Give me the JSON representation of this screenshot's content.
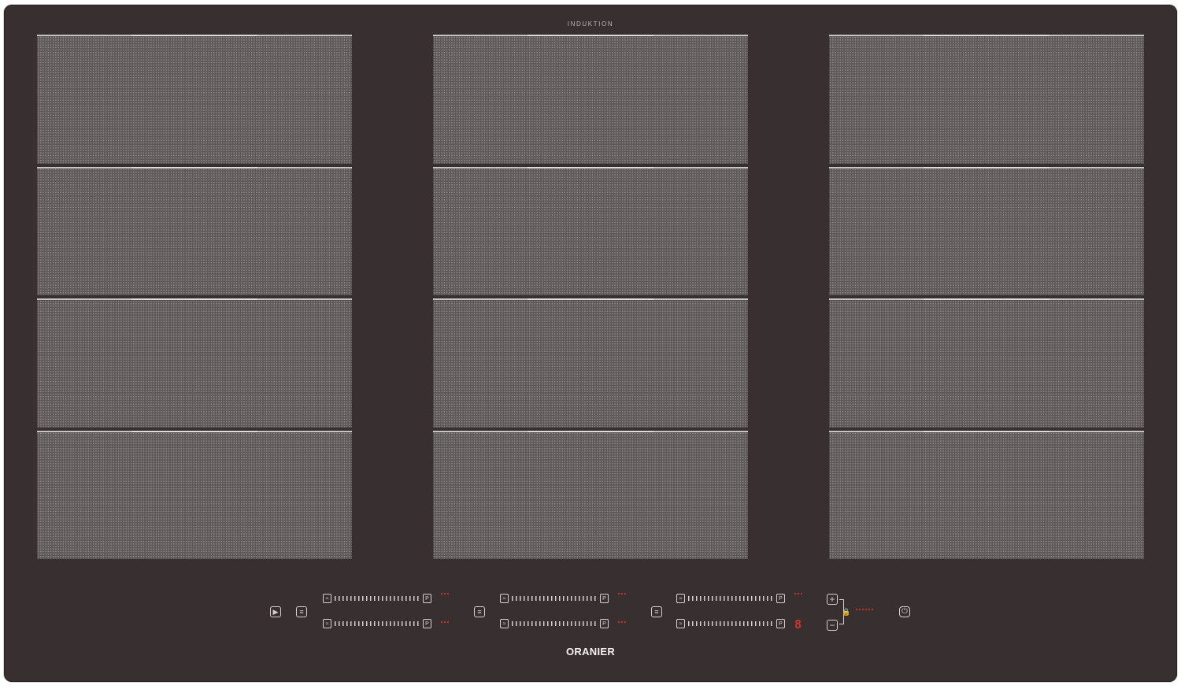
{
  "appliance": {
    "label_top": "INDUKTION",
    "brand": "ORANIER",
    "colors": {
      "glass": "#372f30",
      "zone": "#5e5858",
      "marking": "#d5d1d1",
      "indicator_red": "#d8332c"
    }
  },
  "zones": {
    "columns": [
      {
        "name": "left",
        "segments": 4
      },
      {
        "name": "center",
        "segments": 4
      },
      {
        "name": "right",
        "segments": 4
      }
    ]
  },
  "controls": {
    "play_icon": "play-icon",
    "bridge_icons": [
      "flex-bridge-icon",
      "flex-bridge-icon",
      "flex-bridge-icon"
    ],
    "slider_start_icon": "warm-icon",
    "slider_end_label": "P",
    "sliders": [
      {
        "zone": "left-top"
      },
      {
        "zone": "left-bottom"
      },
      {
        "zone": "center-top"
      },
      {
        "zone": "center-bottom"
      },
      {
        "zone": "right-top"
      },
      {
        "zone": "right-bottom"
      }
    ],
    "timer_plus": "+",
    "timer_minus": "−",
    "timer_display": "8",
    "lock_icon": "lock-icon",
    "power_icon": "power-icon"
  }
}
